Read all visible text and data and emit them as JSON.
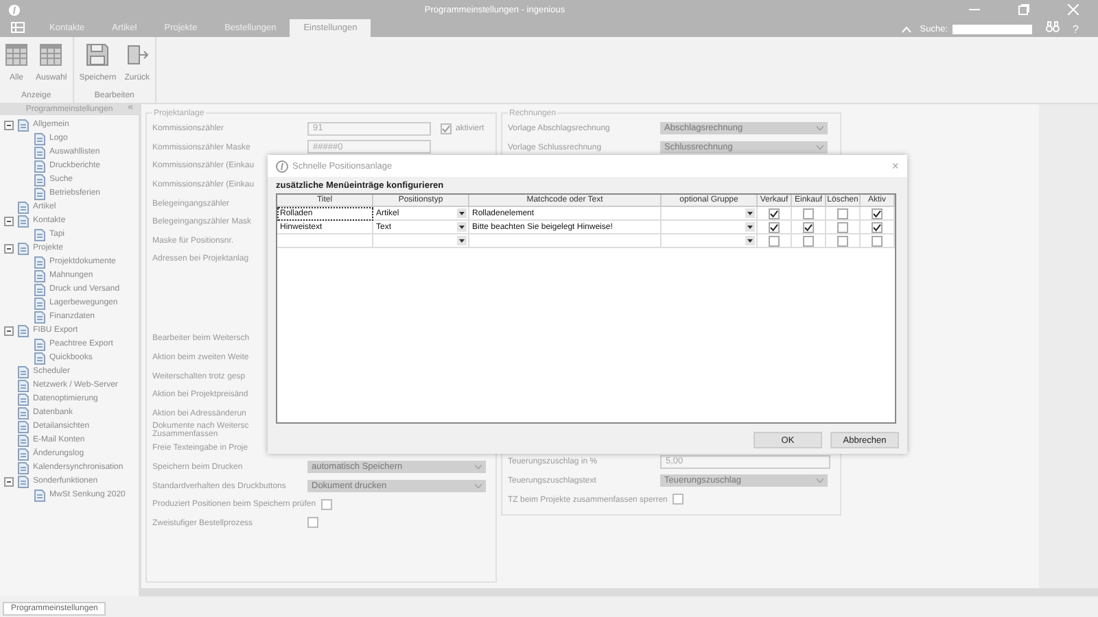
{
  "window": {
    "title": "Programmeinstellungen - ingenious"
  },
  "tabs": [
    {
      "label": "Kontakte",
      "selected": false
    },
    {
      "label": "Artikel",
      "selected": false
    },
    {
      "label": "Projekte",
      "selected": false
    },
    {
      "label": "Bestellungen",
      "selected": false
    },
    {
      "label": "Einstellungen",
      "selected": true
    }
  ],
  "search": {
    "label": "Suche:"
  },
  "help": "?",
  "ribbon": {
    "groups": [
      {
        "label": "Anzeige",
        "buttons": [
          {
            "label": "Alle",
            "kind": "table"
          },
          {
            "label": "Auswahl",
            "kind": "table"
          }
        ]
      },
      {
        "label": "Bearbeiten",
        "buttons": [
          {
            "label": "Speichern",
            "kind": "save"
          },
          {
            "label": "Zurück",
            "kind": "back"
          }
        ]
      }
    ]
  },
  "sidebar": {
    "title": "Programmeinstellungen",
    "collapse": "«",
    "items": [
      {
        "label": "Allgemein",
        "expanded": true,
        "children": [
          {
            "label": "Logo"
          },
          {
            "label": "Auswahllisten"
          },
          {
            "label": "Druckberichte"
          },
          {
            "label": "Suche"
          },
          {
            "label": "Betriebsferien"
          }
        ]
      },
      {
        "label": "Artikel"
      },
      {
        "label": "Kontakte",
        "expanded": true,
        "children": [
          {
            "label": "Tapi"
          }
        ]
      },
      {
        "label": "Projekte",
        "expanded": true,
        "children": [
          {
            "label": "Projektdokumente"
          },
          {
            "label": "Mahnungen"
          },
          {
            "label": "Druck und Versand"
          },
          {
            "label": "Lagerbewegungen"
          },
          {
            "label": "Finanzdaten"
          }
        ]
      },
      {
        "label": "FIBU Export",
        "expanded": true,
        "children": [
          {
            "label": "Peachtree Export"
          },
          {
            "label": "Quickbooks"
          }
        ]
      },
      {
        "label": "Scheduler"
      },
      {
        "label": "Netzwerk / Web-Server"
      },
      {
        "label": "Datenoptimierung"
      },
      {
        "label": "Datenbank"
      },
      {
        "label": "Detailansichten"
      },
      {
        "label": "E-Mail Konten"
      },
      {
        "label": "Änderungslog"
      },
      {
        "label": "Kalendersynchronisation"
      },
      {
        "label": "Sonderfunktionen",
        "expanded": true,
        "children": [
          {
            "label": "MwSt Senkung 2020"
          }
        ]
      }
    ]
  },
  "left_group": {
    "title": "Projektanlage",
    "rows": [
      {
        "kind": "text",
        "label": "Kommissionszähler",
        "value": "91",
        "option": {
          "label": "aktiviert",
          "checked": true
        }
      },
      {
        "kind": "text",
        "label": "Kommissionszähler Maske",
        "value": "#####0"
      },
      {
        "kind": "label",
        "label": "Kommissionszähler (Einkau"
      },
      {
        "kind": "label",
        "label": "Kommissionszähler (Einkau"
      },
      {
        "kind": "label",
        "label": "Belegeingangszähler"
      },
      {
        "kind": "label",
        "label": "Belegeingangszähler Mask"
      },
      {
        "kind": "label",
        "label": "Maske für Positionsnr."
      },
      {
        "kind": "area",
        "label": "Adressen bei Projektanlag"
      },
      {
        "kind": "label",
        "label": "Bearbeiter beim Weitersch"
      },
      {
        "kind": "label",
        "label": "Aktion beim zweiten Weite"
      },
      {
        "kind": "label",
        "label": "Weiterschalten trotz gesp"
      },
      {
        "kind": "label",
        "label": "Aktion bei Projektpreisänd"
      },
      {
        "kind": "label",
        "label": "Aktion bei Adressänderun"
      },
      {
        "kind": "lines",
        "lines": [
          "Dokumente nach Weitersc",
          "Zusammenfassen"
        ]
      },
      {
        "kind": "label",
        "label": "Freie Texteingabe in Proje"
      },
      {
        "kind": "select",
        "label": "Speichern beim Drucken",
        "value": "automatisch Speichern"
      },
      {
        "kind": "select",
        "label": "Standardverhalten des Druckbuttons",
        "value": "Dokument drucken"
      },
      {
        "kind": "checkbox",
        "label": "Produziert Positionen beim Speichern prüfen",
        "checked": false
      },
      {
        "kind": "checkbox",
        "label": "Zweistufiger Bestellprozess",
        "checked": false
      }
    ]
  },
  "right_group": {
    "title": "Rechnungen",
    "top_rows": [
      {
        "kind": "select",
        "label": "Vorlage Abschlagsrechnung",
        "value": "Abschlagsrechnung"
      },
      {
        "kind": "select",
        "label": "Vorlage Schlussrechnung",
        "value": "Schlussrechnung"
      }
    ],
    "bottom_rows": [
      {
        "kind": "text",
        "label": "Teuerungszuschlag in %",
        "value": "5,00"
      },
      {
        "kind": "select",
        "label": "Teuerungszuschlagstext",
        "value": "Teuerungszuschlag"
      },
      {
        "kind": "checkbox",
        "label": "TZ beim Projekte zusammenfassen sperren",
        "checked": false
      }
    ]
  },
  "dialog": {
    "title": "Schnelle Positionsanlage",
    "close": "×",
    "group": "zusätzliche Menüeinträge konfigurieren",
    "columns": [
      "Titel",
      "Positionstyp",
      "Matchcode oder Text",
      "optional Gruppe",
      "Verkauf",
      "Einkauf",
      "Löschen",
      "Aktiv"
    ],
    "rows": [
      {
        "titel": "Rolladen",
        "typ": "Artikel",
        "text": "Rolladenelement",
        "verkauf": true,
        "einkauf": false,
        "loeschen": false,
        "aktiv": true
      },
      {
        "titel": "Hinweistext",
        "typ": "Text",
        "text": "Bitte beachten Sie beigelegt Hinweise!",
        "verkauf": true,
        "einkauf": true,
        "loeschen": false,
        "aktiv": true
      },
      {
        "verkauf": false,
        "einkauf": false,
        "loeschen": false,
        "aktiv": false
      }
    ],
    "buttons": [
      "OK",
      "Abbrechen"
    ]
  },
  "bottom_tabs": [
    {
      "label": "Programmeinstellungen",
      "selected": true
    }
  ]
}
